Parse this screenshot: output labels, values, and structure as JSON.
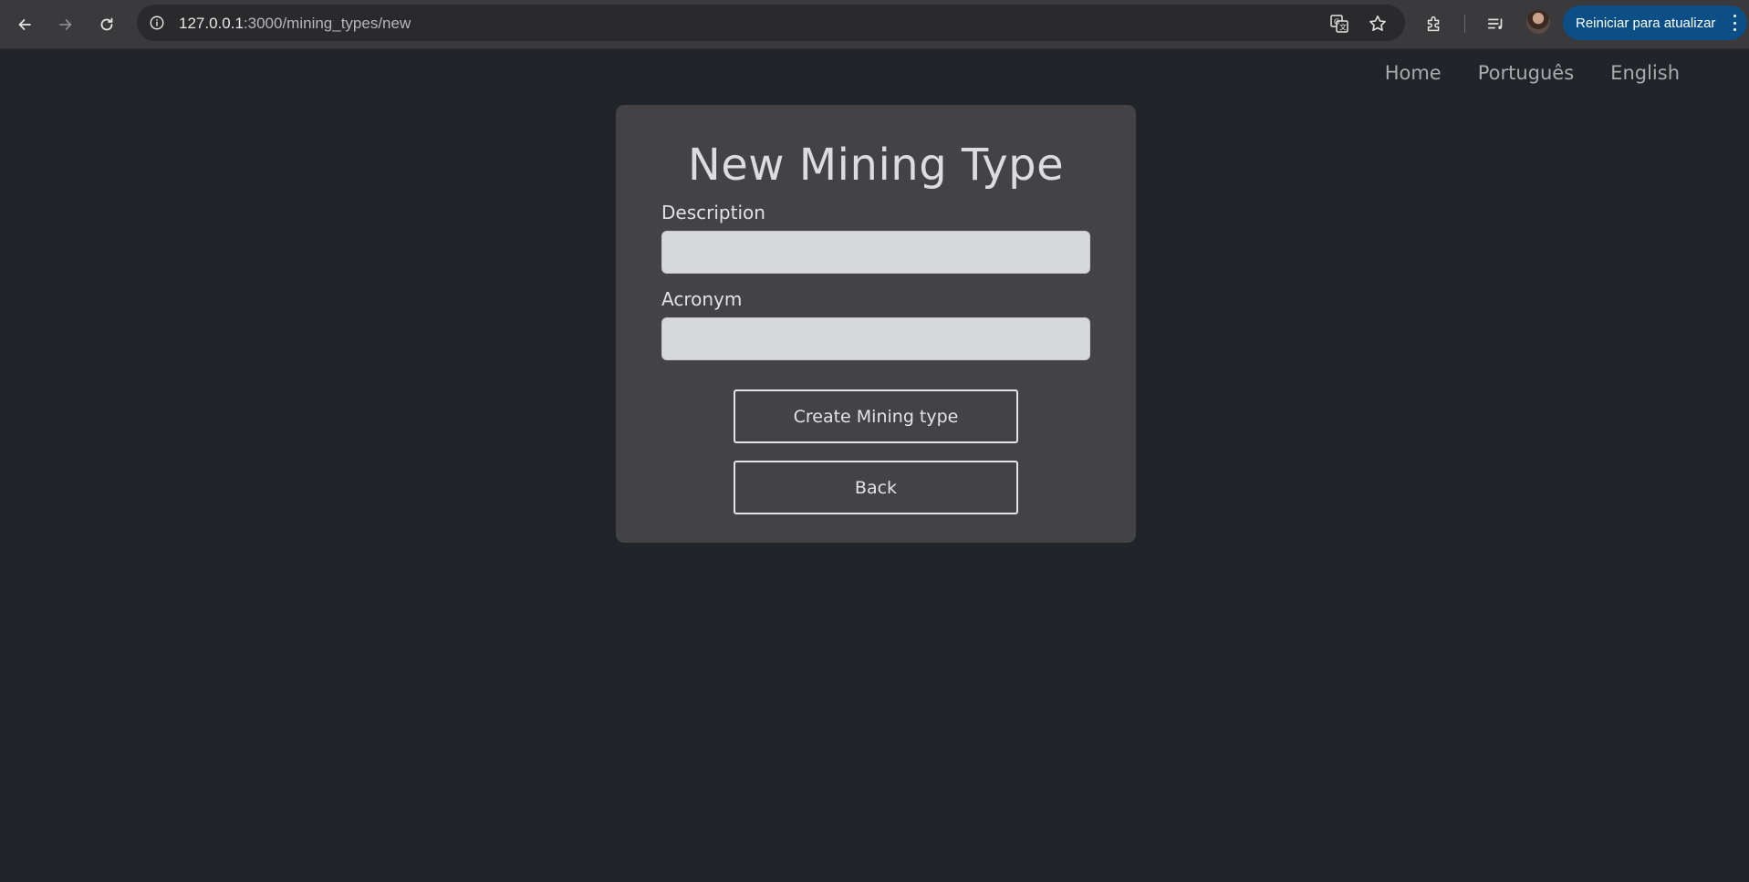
{
  "browser": {
    "url_host": "127.0.0.1",
    "url_path": ":3000/mining_types/new",
    "update_button_label": "Reiniciar para atualizar",
    "icons": [
      "back-icon",
      "forward-icon",
      "reload-icon",
      "site-info-icon",
      "translate-icon",
      "bookmark-star-icon",
      "extensions-icon",
      "reading-list-icon",
      "profile-avatar",
      "menu-kebab-icon"
    ],
    "accent_color": "#0b4f86"
  },
  "nav": {
    "home": "Home",
    "portuguese": "Português",
    "english": "English"
  },
  "form": {
    "title": "New Mining Type",
    "description_label": "Description",
    "description_value": "",
    "acronym_label": "Acronym",
    "acronym_value": "",
    "submit_label": "Create Mining type",
    "back_label": "Back"
  },
  "colors": {
    "page_background": "#212429",
    "card_background": "#434346",
    "input_background": "#d6d8da"
  }
}
